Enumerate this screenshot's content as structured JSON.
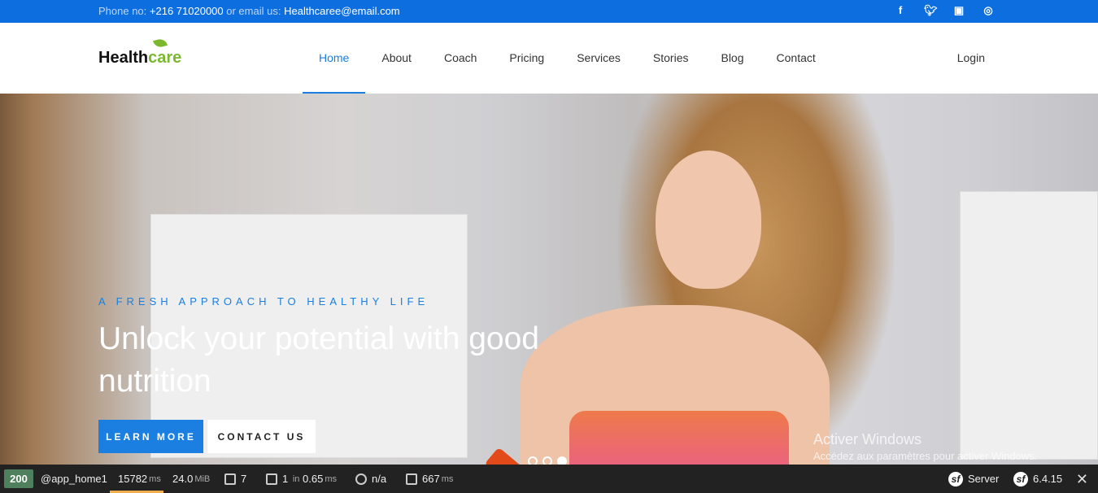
{
  "topbar": {
    "phone_label": "Phone no:",
    "phone": "+216 71020000",
    "email_label": "or email us:",
    "email": "Healthcaree@email.com",
    "social_icons": [
      "facebook-icon",
      "twitter-icon",
      "instagram-icon",
      "dribbble-icon"
    ]
  },
  "brand": {
    "part1": "Health",
    "part2": "care"
  },
  "nav": {
    "items": [
      "Home",
      "About",
      "Coach",
      "Pricing",
      "Services",
      "Stories",
      "Blog",
      "Contact"
    ],
    "active": "Home",
    "login": "Login"
  },
  "hero": {
    "tagline": "A FRESH APPROACH TO HEALTHY LIFE",
    "headline": "Unlock your potential with good nutrition",
    "learn_more": "LEARN MORE",
    "contact_us": "CONTACT US",
    "slides": 3,
    "active_slide": 3
  },
  "watermark": {
    "title": "Activer Windows",
    "subtitle": "Accédez aux paramètres pour activer Windows."
  },
  "debug_toolbar": {
    "status": "200",
    "route": "@app_home1",
    "time": "15782",
    "time_unit": "ms",
    "memory": "24.0",
    "memory_unit": "MiB",
    "templates": "7",
    "cache_calls": "1",
    "cache_in": "in",
    "cache_time": "0.65",
    "cache_unit": "ms",
    "user": "n/a",
    "server_time": "667",
    "server_unit": "ms",
    "server_label": "Server",
    "version": "6.4.15"
  },
  "colors": {
    "accent": "#1a7fe0",
    "topbar": "#0d6ee0",
    "brand_green": "#7cb82f",
    "status_ok": "#4f805d"
  }
}
